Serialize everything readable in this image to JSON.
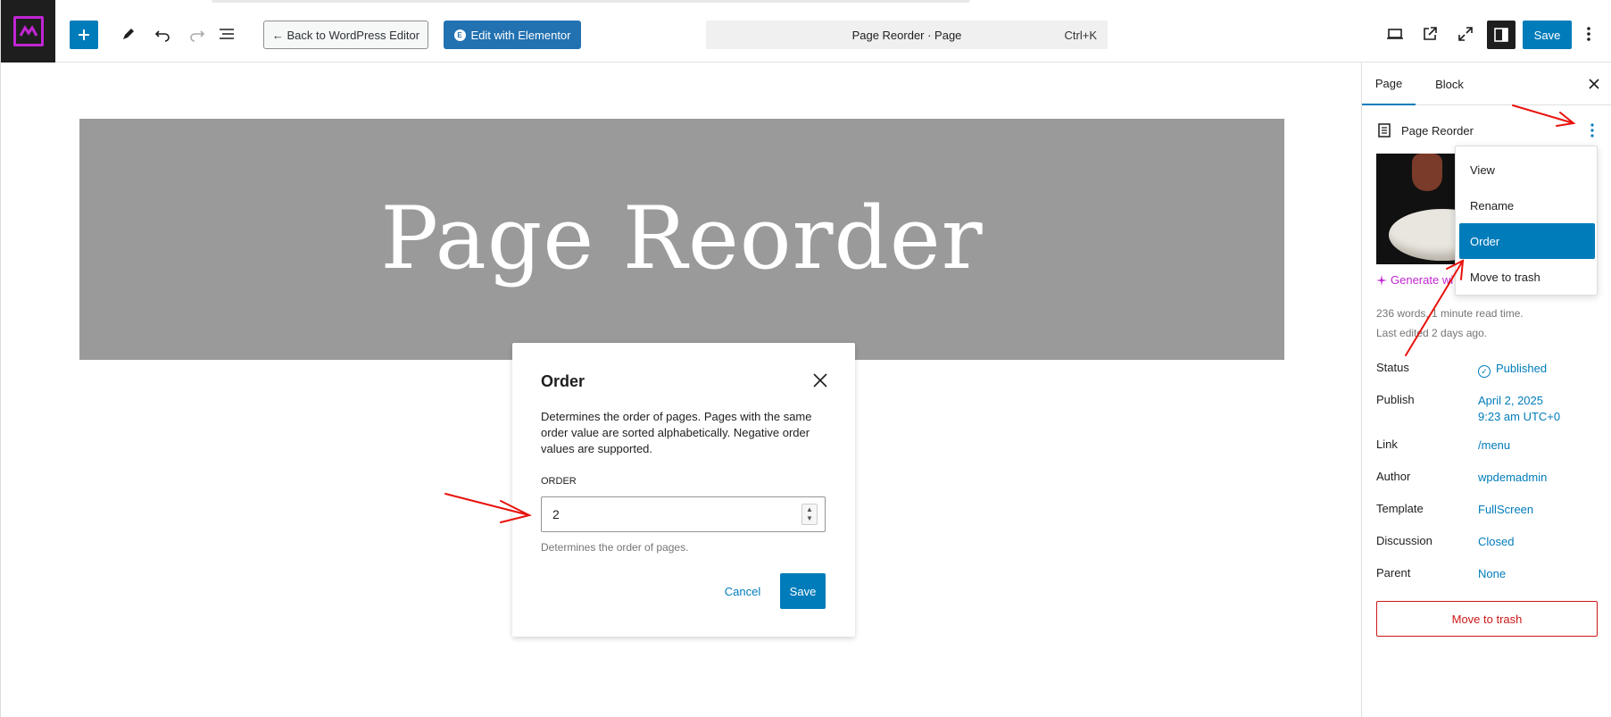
{
  "header": {
    "back_label": "← Back to WordPress Editor",
    "elementor_label": "Edit with Elementor",
    "command_title": "Page Reorder · Page",
    "command_shortcut": "Ctrl+K",
    "save_label": "Save",
    "icons": [
      "plus-icon",
      "pen-icon",
      "undo-icon",
      "redo-icon",
      "list-view-icon",
      "desktop-icon",
      "external-icon",
      "fullscreen-icon",
      "sidebar-icon",
      "more-icon"
    ]
  },
  "canvas": {
    "hero_title": "Page Reorder"
  },
  "modal": {
    "title": "Order",
    "description": "Determines the order of pages. Pages with the same order value are sorted alphabetically. Negative order values are supported.",
    "field_label": "ORDER",
    "field_value": "2",
    "help": "Determines the order of pages.",
    "cancel_label": "Cancel",
    "save_label": "Save"
  },
  "sidebar": {
    "tabs": [
      {
        "label": "Page",
        "active": true
      },
      {
        "label": "Block",
        "active": false
      }
    ],
    "document_title": "Page Reorder",
    "generate_label": "Generate wi",
    "meta_words": "236 words, 1 minute read time.",
    "meta_edited": "Last edited 2 days ago.",
    "fields": [
      {
        "label": "Status",
        "value": "Published"
      },
      {
        "label": "Publish",
        "value": "April 2, 2025",
        "value2": "9:23 am UTC+0"
      },
      {
        "label": "Link",
        "value": "/menu"
      },
      {
        "label": "Author",
        "value": "wpdemadmin"
      },
      {
        "label": "Template",
        "value": "FullScreen"
      },
      {
        "label": "Discussion",
        "value": "Closed"
      },
      {
        "label": "Parent",
        "value": "None"
      }
    ],
    "trash_label": "Move to trash"
  },
  "dropdown": {
    "items": [
      {
        "label": "View",
        "selected": false
      },
      {
        "label": "Rename",
        "selected": false
      },
      {
        "label": "Order",
        "selected": true
      },
      {
        "label": "Move to trash",
        "selected": false
      }
    ]
  },
  "colors": {
    "accent": "#007cba",
    "elementor": "#2271b1",
    "danger": "#cc1818",
    "annotation": "#e8120c",
    "logo": "#c026d3"
  }
}
